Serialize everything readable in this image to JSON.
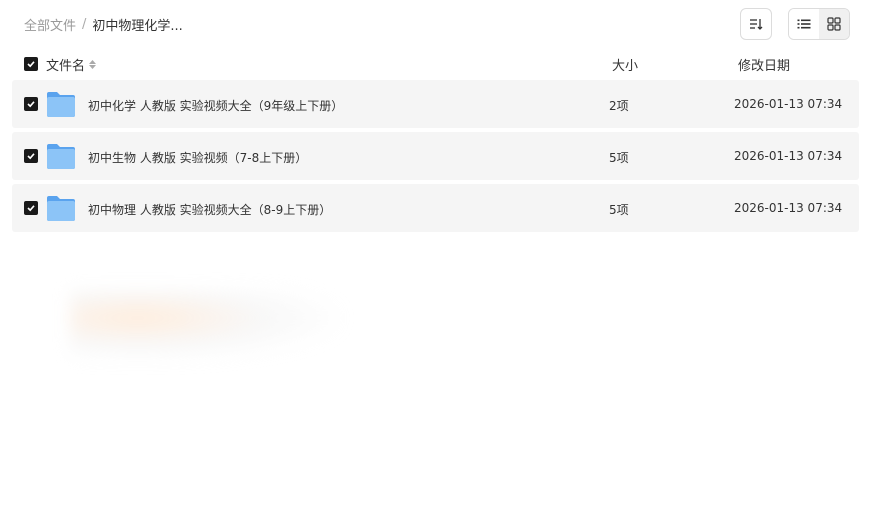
{
  "breadcrumb": {
    "root": "全部文件",
    "separator": "/",
    "current": "初中物理化学..."
  },
  "toolbar": {
    "sort_icon": "sort-icon",
    "list_view_icon": "list-view-icon",
    "grid_view_icon": "grid-view-icon"
  },
  "columns": {
    "name": "文件名",
    "size": "大小",
    "date": "修改日期"
  },
  "files": [
    {
      "name": "初中化学 人教版 实验视频大全（9年级上下册）",
      "size": "2项",
      "date": "2026-01-13 07:34",
      "checked": true
    },
    {
      "name": "初中生物 人教版 实验视频（7-8上下册）",
      "size": "5项",
      "date": "2026-01-13 07:34",
      "checked": true
    },
    {
      "name": "初中物理 人教版 实验视频大全（8-9上下册）",
      "size": "5项",
      "date": "2026-01-13 07:34",
      "checked": true
    }
  ],
  "colors": {
    "checkbox": "#1a1a1a",
    "row_bg": "#f5f5f5",
    "folder": "#7ab8f5"
  }
}
